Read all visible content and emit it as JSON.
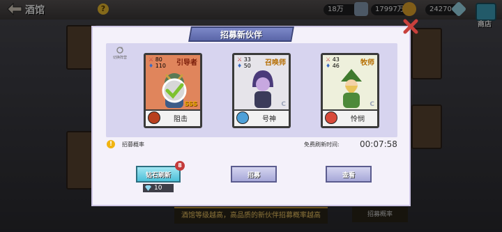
{
  "topbar": {
    "title": "酒馆",
    "help": "?",
    "resources": [
      {
        "name": "resource-1",
        "value": "18万"
      },
      {
        "name": "gold",
        "value": "17997万"
      },
      {
        "name": "diamond",
        "value": "24270"
      }
    ],
    "shop_label": "商店"
  },
  "modal": {
    "title": "招募新伙伴",
    "refresh_label": "切换阵营",
    "cards": [
      {
        "cls": "引导者",
        "atk": "80",
        "hp": "110",
        "skill": "阻击",
        "rarity": "SSS",
        "bg": "#e0855c",
        "cls_color": "#7a1d0a",
        "selected": true
      },
      {
        "cls": "召唤师",
        "atk": "33",
        "hp": "50",
        "skill": "号神",
        "rarity": "C",
        "bg": "#e6e4ea",
        "cls_color": "#b56d00",
        "selected": false
      },
      {
        "cls": "牧师",
        "atk": "43",
        "hp": "46",
        "skill": "怜悯",
        "rarity": "C",
        "bg": "#eef0dc",
        "cls_color": "#b56d00",
        "selected": false
      }
    ],
    "prob_icon": "!",
    "prob_label": "招募概率",
    "free_label": "免费刷新时间:",
    "free_time": "00:07:58",
    "buttons": {
      "diamond_refresh": "钻石刷新",
      "recruit": "招募",
      "view": "查看"
    },
    "badge": "8",
    "cost": "10"
  },
  "bottom": {
    "tip": "酒馆等级越高，高品质的新伙伴招募概率越高",
    "tab": "招募概率"
  }
}
